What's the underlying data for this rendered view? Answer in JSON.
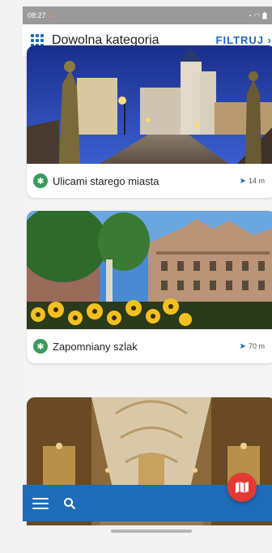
{
  "status_bar": {
    "time": "08:27",
    "icons": [
      "heart-icon",
      "alarm-icon",
      "wifi-icon",
      "battery-icon"
    ]
  },
  "header": {
    "category": "Dowolna kategoria",
    "filter": "FILTRUJ"
  },
  "routes": [
    {
      "title": "Ulicami starego miasta",
      "distance": "14 m",
      "image": "old-town-night-photo"
    },
    {
      "title": "Zapomniany szlak",
      "distance": "70 m",
      "image": "historic-building-flowers-photo"
    },
    {
      "title": "",
      "distance": "",
      "image": "basilica-interior-photo"
    }
  ],
  "colors": {
    "primary": "#1f6cb8",
    "fab": "#e53935",
    "walk_badge": "#3a9a5a"
  },
  "bottom_bar": {
    "icons": [
      "menu-icon",
      "search-icon",
      "map-icon"
    ]
  }
}
